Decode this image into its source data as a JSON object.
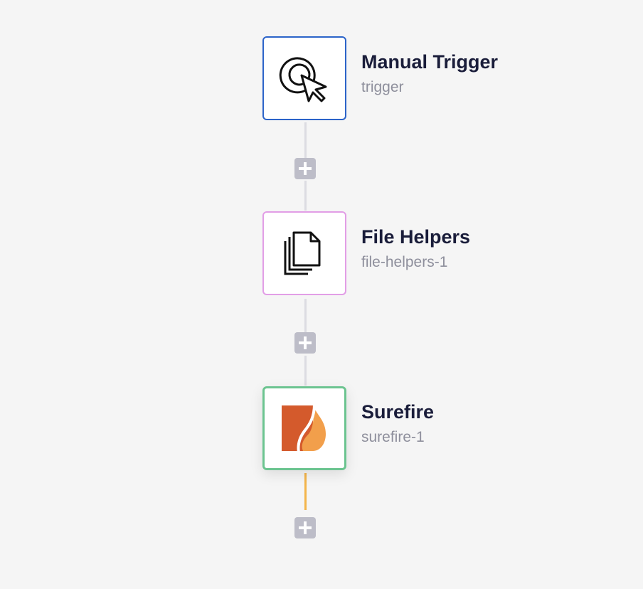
{
  "workflow": {
    "steps": [
      {
        "title": "Manual Trigger",
        "subtitle": "trigger",
        "icon": "cursor-click-icon",
        "border_color": "#2c64c9"
      },
      {
        "title": "File Helpers",
        "subtitle": "file-helpers-1",
        "icon": "files-icon",
        "border_color": "#e29ee6"
      },
      {
        "title": "Surefire",
        "subtitle": "surefire-1",
        "icon": "surefire-logo-icon",
        "border_color": "#6cc490"
      }
    ],
    "connector_colors": {
      "default": "#dcdce2",
      "active": "#f4b54a"
    },
    "add_button_color": "#bdbdc8"
  }
}
